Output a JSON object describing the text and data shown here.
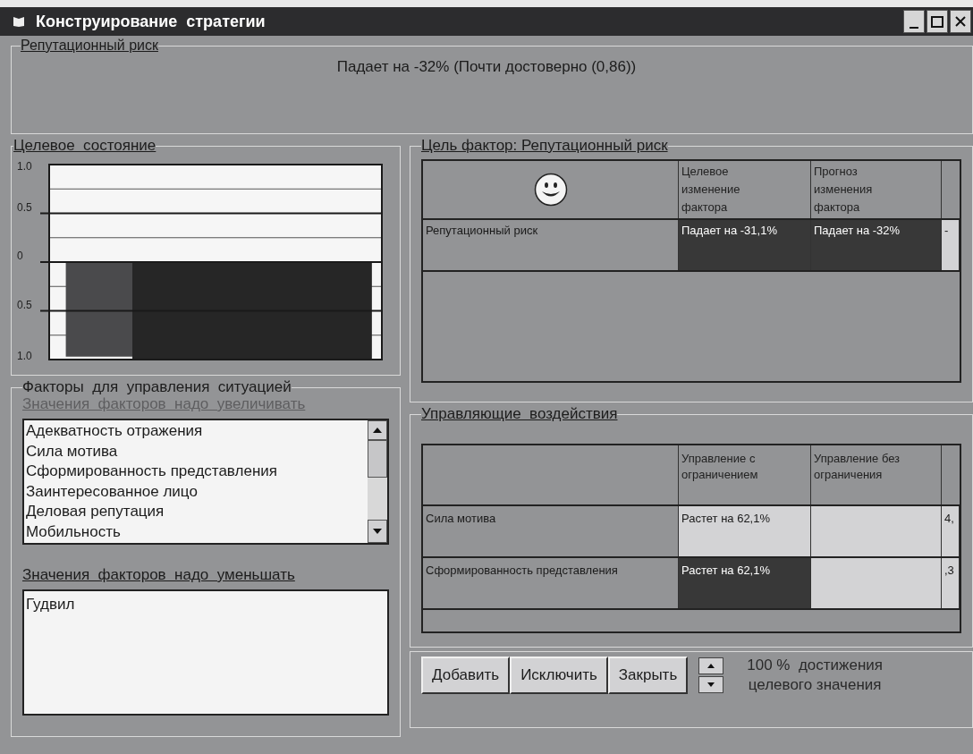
{
  "window": {
    "title": "Конструирование  стратегии"
  },
  "risk_group": {
    "title": "Репутационный риск",
    "summary": "Падает на -32% (Почти достоверно (0,86))"
  },
  "target_state": {
    "title": "Целевое  состояние",
    "chart_data": {
      "type": "bar",
      "series": [
        {
          "color": "#4a4a4c",
          "values": [
            -0.97
          ]
        },
        {
          "color": "#262626",
          "values": [
            -1
          ]
        }
      ],
      "grid": true,
      "ylim": [
        -1,
        1
      ],
      "yticks": [
        {
          "value": 1,
          "label": "1.0"
        },
        {
          "value": 0.5,
          "label": "0.5"
        },
        {
          "value": 0,
          "label": "0"
        },
        {
          "value": -0.5,
          "label": "0.5"
        },
        {
          "value": -1,
          "label": "1.0"
        }
      ]
    }
  },
  "factors": {
    "title": "Факторы  для  управления  ситуацией",
    "increase_label": "Значения  факторов  надо  увеличивать",
    "increase_items": [
      "Адекватность отражения",
      "Сила мотива",
      "Сформированность представления",
      "Заинтересованное лицо",
      "Деловая репутация",
      "Мобильность"
    ],
    "decrease_label": "Значения  факторов  надо  уменьшать",
    "decrease_items": [
      "Гудвил"
    ]
  },
  "goal": {
    "title": "Цель фактор: Репутационный риск",
    "columns": [
      "Целевое изменение фактора",
      "Прогноз изменения фактора"
    ],
    "rows": [
      {
        "name": "Репутационный риск",
        "cells": [
          {
            "text": "Падает на -31,1%",
            "selected": true
          },
          {
            "text": "Падает на -32%",
            "selected": true
          },
          {
            "text": "-",
            "selected": false
          }
        ]
      }
    ]
  },
  "controls": {
    "title": "Управляющие  воздействия",
    "columns": [
      "Управление с ограничением",
      "Управление без ограничения"
    ],
    "rows": [
      {
        "name": "Сила мотива",
        "cells": [
          {
            "text": "Растет на 62,1%",
            "selected": false
          },
          {
            "selected": false
          },
          {
            "text": "4,",
            "selected": false
          }
        ]
      },
      {
        "name": "Сформированность представления",
        "cells": [
          {
            "text": "Растет на 62,1%",
            "selected": true
          },
          {
            "selected": false
          },
          {
            "text": ",3",
            "selected": false
          }
        ]
      }
    ]
  },
  "buttons": [
    "Добавить",
    "Исключить",
    "Закрыть"
  ],
  "progress_lines": [
    "100 %  достижения",
    "целевого значения"
  ]
}
